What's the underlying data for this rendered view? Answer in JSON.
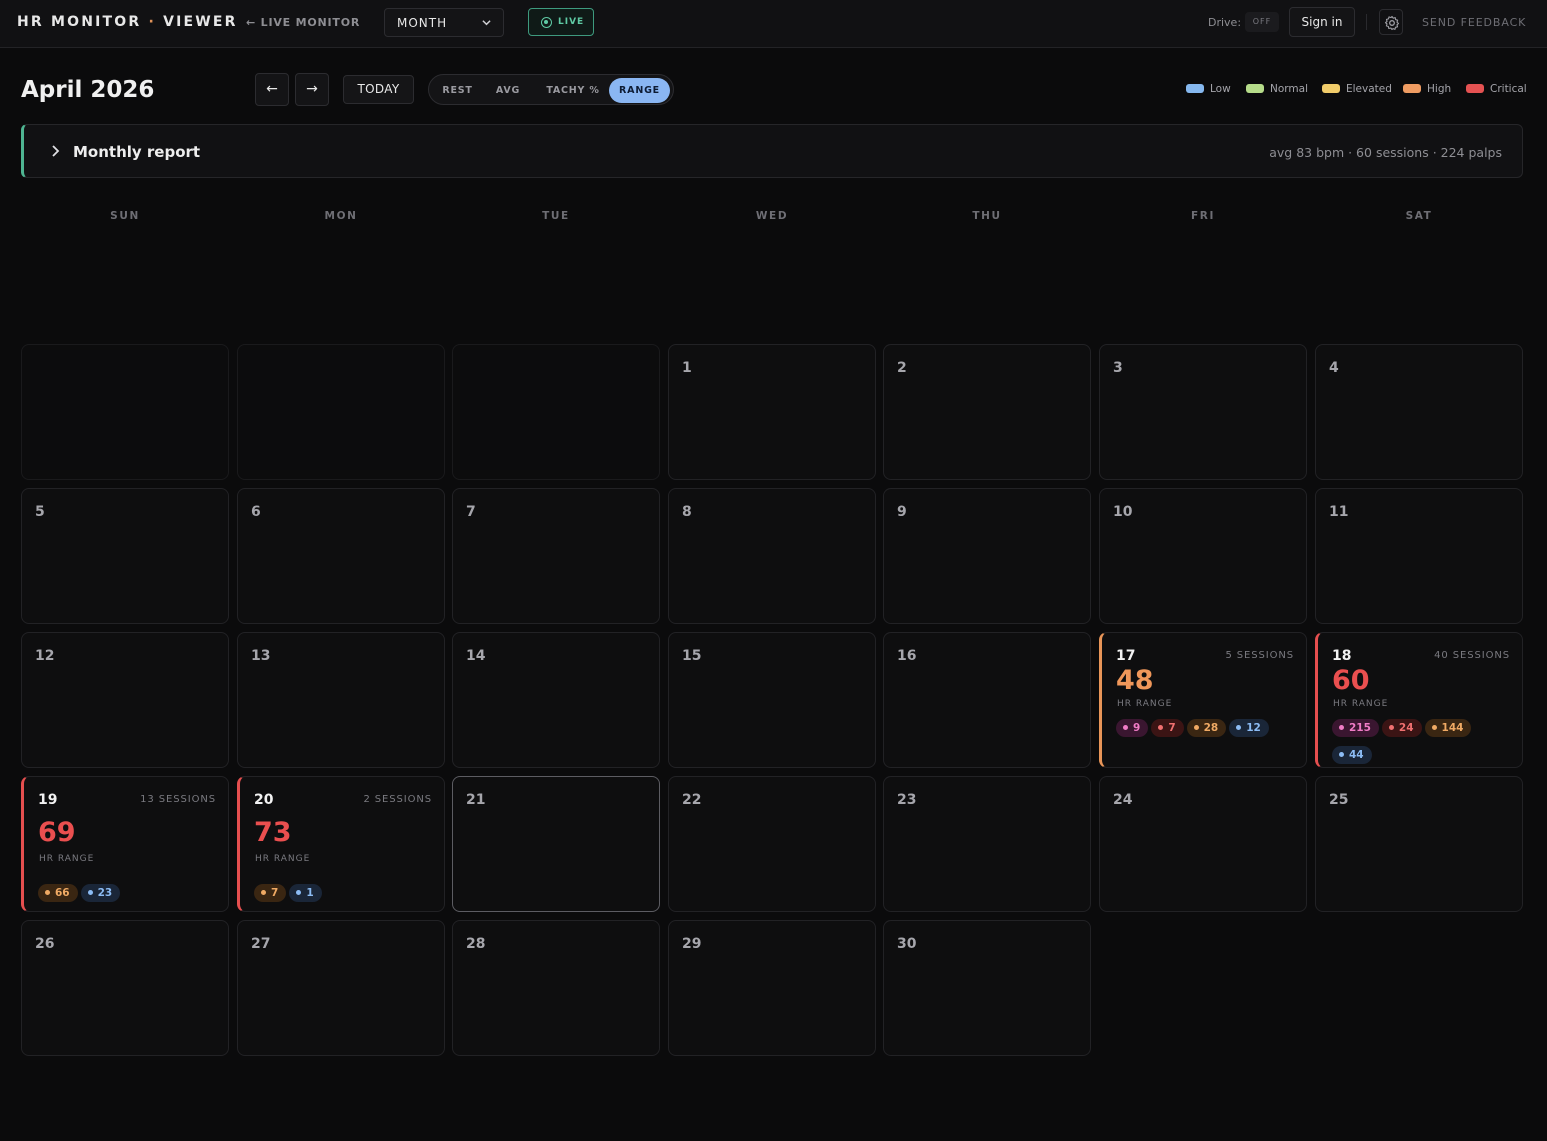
{
  "topbar": {
    "brand_left": "HR MONITOR",
    "brand_sep": "·",
    "brand_right": "VIEWER",
    "live_monitor_link": "← LIVE MONITOR",
    "view_select_value": "MONTH",
    "live_button": "LIVE",
    "drive_label": "Drive:",
    "drive_toggle": "OFF",
    "sign_in": "Sign in",
    "send_feedback": "SEND FEEDBACK"
  },
  "controls": {
    "month_title": "April 2026",
    "prev": "←",
    "next": "→",
    "today": "TODAY",
    "modes": [
      "REST",
      "AVG",
      "TACHY %",
      "RANGE"
    ],
    "active_mode": "RANGE"
  },
  "legend": [
    {
      "label": "Low",
      "color": "#86b8ef"
    },
    {
      "label": "Normal",
      "color": "#b6dc8a"
    },
    {
      "label": "Elevated",
      "color": "#f1cc6a"
    },
    {
      "label": "High",
      "color": "#ef9c62"
    },
    {
      "label": "Critical",
      "color": "#e55252"
    }
  ],
  "report": {
    "title": "Monthly report",
    "summary": "avg 83 bpm · 60 sessions · 224 palps"
  },
  "weekdays": [
    "SUN",
    "MON",
    "TUE",
    "WED",
    "THU",
    "FRI",
    "SAT"
  ],
  "metric_label": "HR RANGE",
  "days": [
    {
      "day": "1"
    },
    {
      "day": "2"
    },
    {
      "day": "3"
    },
    {
      "day": "4"
    },
    {
      "day": "5"
    },
    {
      "day": "6"
    },
    {
      "day": "7"
    },
    {
      "day": "8"
    },
    {
      "day": "9"
    },
    {
      "day": "10"
    },
    {
      "day": "11"
    },
    {
      "day": "12"
    },
    {
      "day": "13"
    },
    {
      "day": "14"
    },
    {
      "day": "15"
    },
    {
      "day": "16"
    },
    {
      "day": "17",
      "sessions": "5 SESSIONS",
      "value": "48",
      "level": "high",
      "chips": [
        {
          "v": "9",
          "c": "pink"
        },
        {
          "v": "7",
          "c": "red"
        },
        {
          "v": "28",
          "c": "orange"
        },
        {
          "v": "12",
          "c": "blue"
        }
      ]
    },
    {
      "day": "18",
      "sessions": "40 SESSIONS",
      "value": "60",
      "level": "crit",
      "chips": [
        {
          "v": "215",
          "c": "pink"
        },
        {
          "v": "24",
          "c": "red"
        },
        {
          "v": "144",
          "c": "orange"
        },
        {
          "v": "44",
          "c": "blue"
        }
      ]
    },
    {
      "day": "19",
      "sessions": "13 SESSIONS",
      "value": "69",
      "level": "crit",
      "chips": [
        {
          "v": "66",
          "c": "orange"
        },
        {
          "v": "23",
          "c": "blue"
        }
      ]
    },
    {
      "day": "20",
      "sessions": "2 SESSIONS",
      "value": "73",
      "level": "crit",
      "chips": [
        {
          "v": "7",
          "c": "orange"
        },
        {
          "v": "1",
          "c": "blue"
        }
      ]
    },
    {
      "day": "21",
      "today": true
    },
    {
      "day": "22"
    },
    {
      "day": "23"
    },
    {
      "day": "24"
    },
    {
      "day": "25"
    },
    {
      "day": "26"
    },
    {
      "day": "27"
    },
    {
      "day": "28"
    },
    {
      "day": "29"
    },
    {
      "day": "30"
    }
  ]
}
